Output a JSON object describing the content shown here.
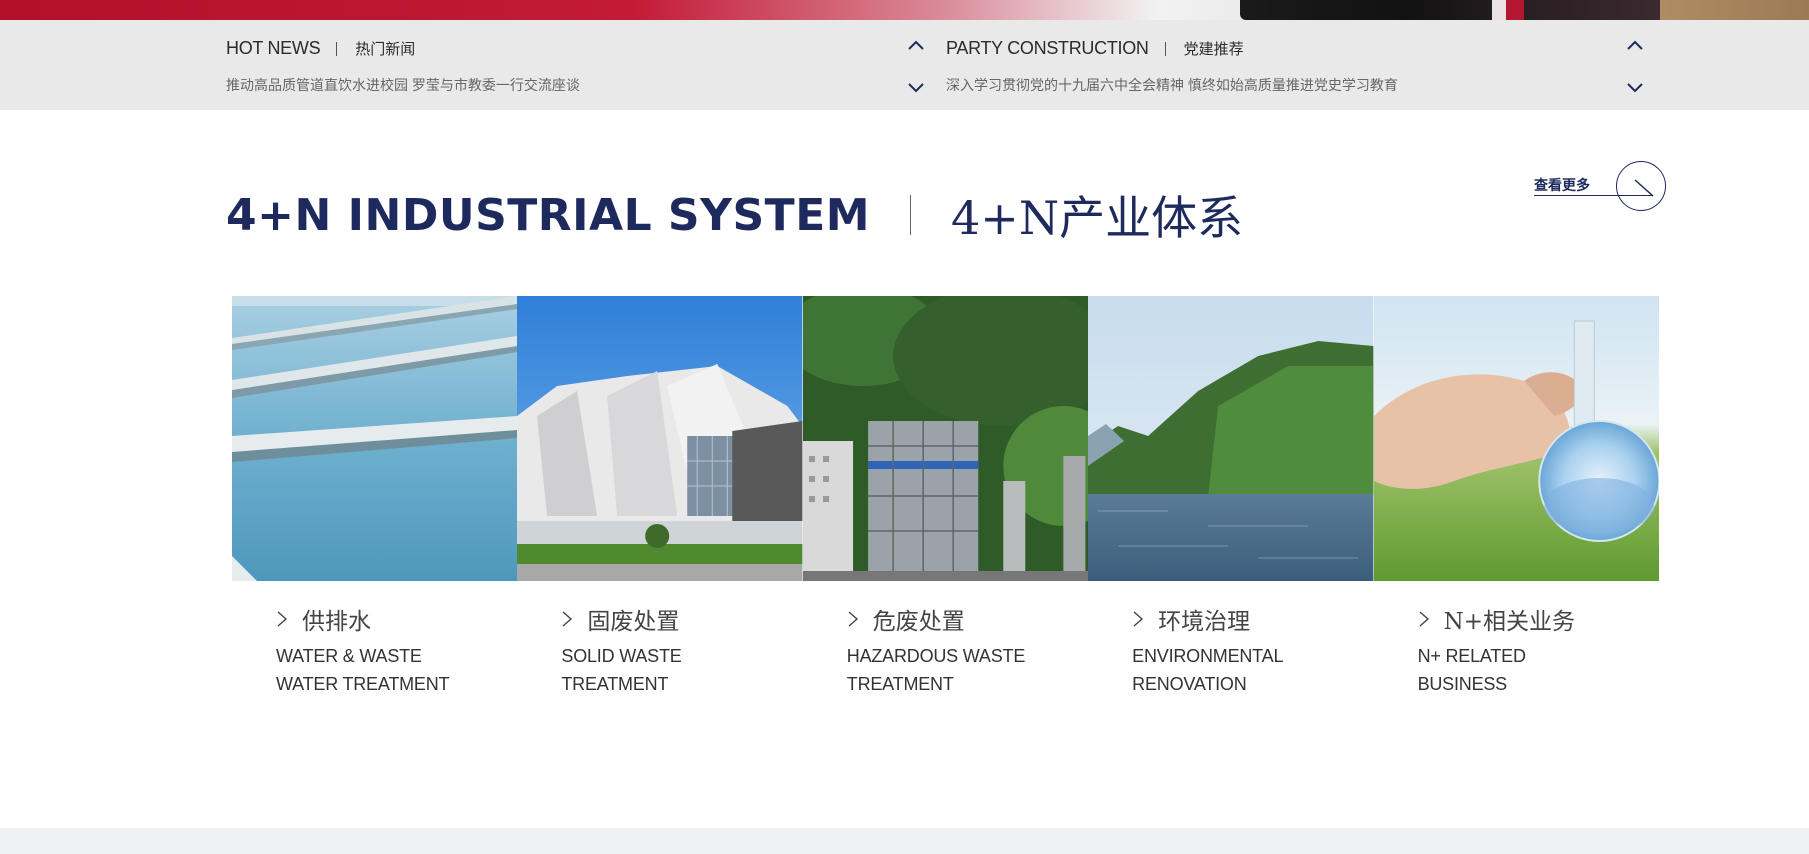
{
  "colors": {
    "navy": "#1e2a5e",
    "banner_red": "#b3102a",
    "newsbar_bg": "#e9e9e9"
  },
  "hot_news": {
    "title_en": "HOT NEWS",
    "title_cn": "热门新闻",
    "headline": "推动高品质管道直饮水进校园 罗莹与市教委一行交流座谈",
    "up_icon": "chevron-up-icon",
    "down_icon": "chevron-down-icon"
  },
  "party": {
    "title_en": "PARTY CONSTRUCTION",
    "title_cn": "党建推荐",
    "headline": "深入学习贯彻党的十九届六中全会精神 慎终如始高质量推进党史学习教育",
    "up_icon": "chevron-up-icon",
    "down_icon": "chevron-down-icon"
  },
  "section": {
    "title_en": "4+N INDUSTRIAL SYSTEM",
    "title_cn": "4+N产业体系",
    "more_label": "查看更多",
    "more_icon": "arrow-down-right-icon"
  },
  "cards": [
    {
      "cn": "供排水",
      "en_line1": "WATER & WASTE",
      "en_line2": "WATER TREATMENT",
      "image": "water-treatment-pool"
    },
    {
      "cn": "固废处置",
      "en_line1": "SOLID WASTE",
      "en_line2": "TREATMENT",
      "image": "modern-building"
    },
    {
      "cn": "危废处置",
      "en_line1": "HAZARDOUS WASTE",
      "en_line2": "TREATMENT",
      "image": "industrial-plant"
    },
    {
      "cn": "环境治理",
      "en_line1": "ENVIRONMENTAL",
      "en_line2": "RENOVATION",
      "image": "lake-and-mountains"
    },
    {
      "cn": "N+相关业务",
      "en_line1": "N+ RELATED",
      "en_line2": "BUSINESS",
      "image": "hand-holding-flask"
    }
  ]
}
